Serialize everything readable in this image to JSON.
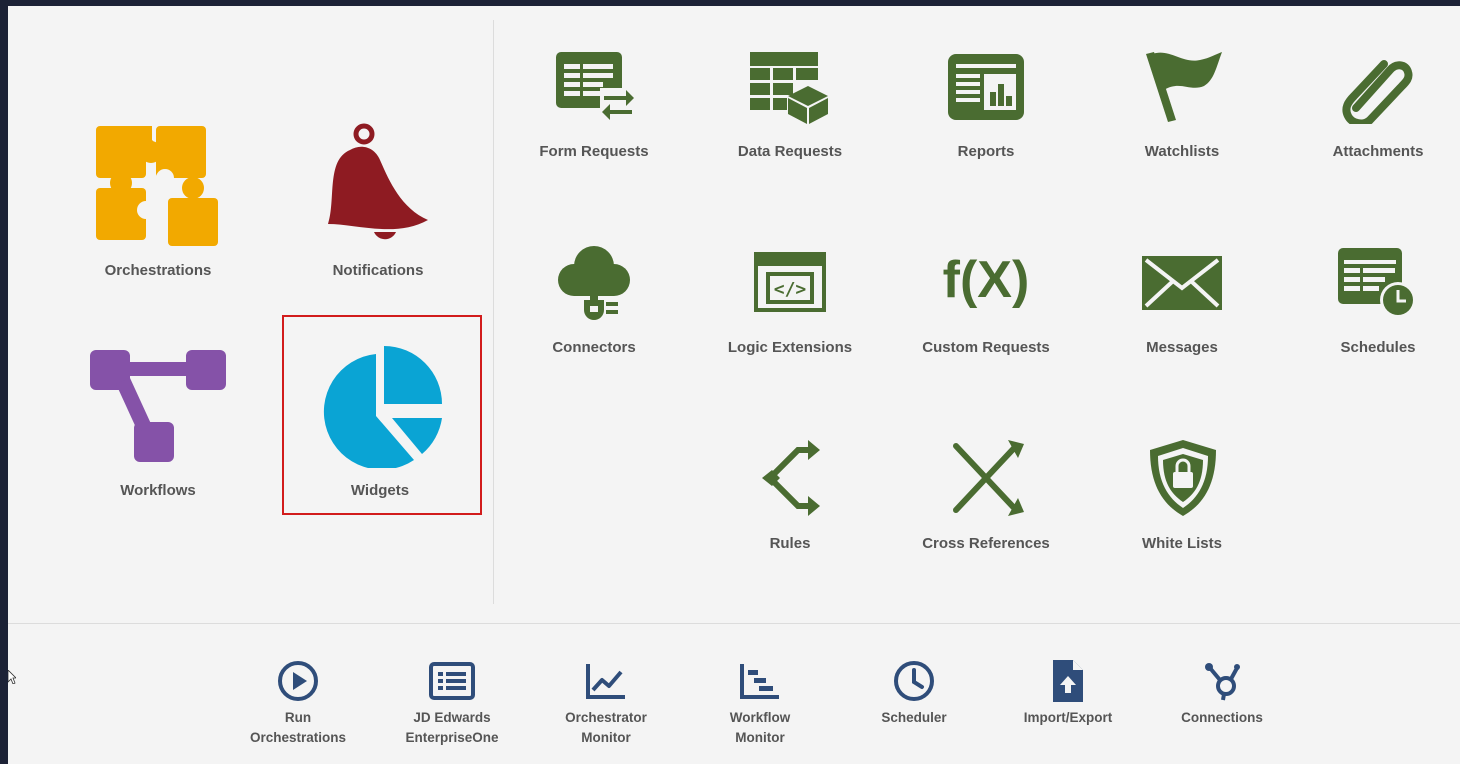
{
  "colors": {
    "orchestration_orange": "#f2a900",
    "notification_red": "#8e1b22",
    "workflow_purple": "#8552a8",
    "widget_blue": "#0aa4d4",
    "design_green": "#4a6c31",
    "utility_navy": "#2f4d7a",
    "highlight_red": "#d21c1c",
    "label_gray": "#555555"
  },
  "main_tiles": [
    {
      "label": "Orchestrations",
      "icon": "puzzle-icon"
    },
    {
      "label": "Notifications",
      "icon": "bell-icon"
    },
    {
      "label": "Workflows",
      "icon": "workflow-icon"
    },
    {
      "label": "Widgets",
      "icon": "pie-chart-icon",
      "highlighted": true
    }
  ],
  "design_tiles": [
    {
      "label": "Form Requests",
      "icon": "form-request-icon"
    },
    {
      "label": "Data Requests",
      "icon": "data-request-icon"
    },
    {
      "label": "Reports",
      "icon": "report-icon"
    },
    {
      "label": "Watchlists",
      "icon": "flag-icon"
    },
    {
      "label": "Attachments",
      "icon": "paperclip-icon"
    },
    {
      "label": "Connectors",
      "icon": "cloud-plug-icon"
    },
    {
      "label": "Logic Extensions",
      "icon": "code-window-icon"
    },
    {
      "label": "Custom Requests",
      "icon": "function-icon",
      "icon_text": "f(X)"
    },
    {
      "label": "Messages",
      "icon": "envelope-icon"
    },
    {
      "label": "Schedules",
      "icon": "calendar-clock-icon"
    },
    {
      "label": "Rules",
      "icon": "branch-arrows-icon"
    },
    {
      "label": "Cross References",
      "icon": "shuffle-icon"
    },
    {
      "label": "White Lists",
      "icon": "shield-lock-icon"
    }
  ],
  "utility_tiles": [
    {
      "line1": "Run",
      "line2": "Orchestrations",
      "icon": "play-circle-icon"
    },
    {
      "line1": "JD Edwards",
      "line2": "EnterpriseOne",
      "icon": "list-window-icon"
    },
    {
      "line1": "Orchestrator",
      "line2": "Monitor",
      "icon": "line-chart-icon"
    },
    {
      "line1": "Workflow",
      "line2": "Monitor",
      "icon": "gantt-chart-icon"
    },
    {
      "line1": "Scheduler",
      "line2": "",
      "icon": "clock-icon"
    },
    {
      "line1": "Import/Export",
      "line2": "",
      "icon": "file-upload-icon"
    },
    {
      "line1": "Connections",
      "line2": "",
      "icon": "hub-icon"
    }
  ]
}
